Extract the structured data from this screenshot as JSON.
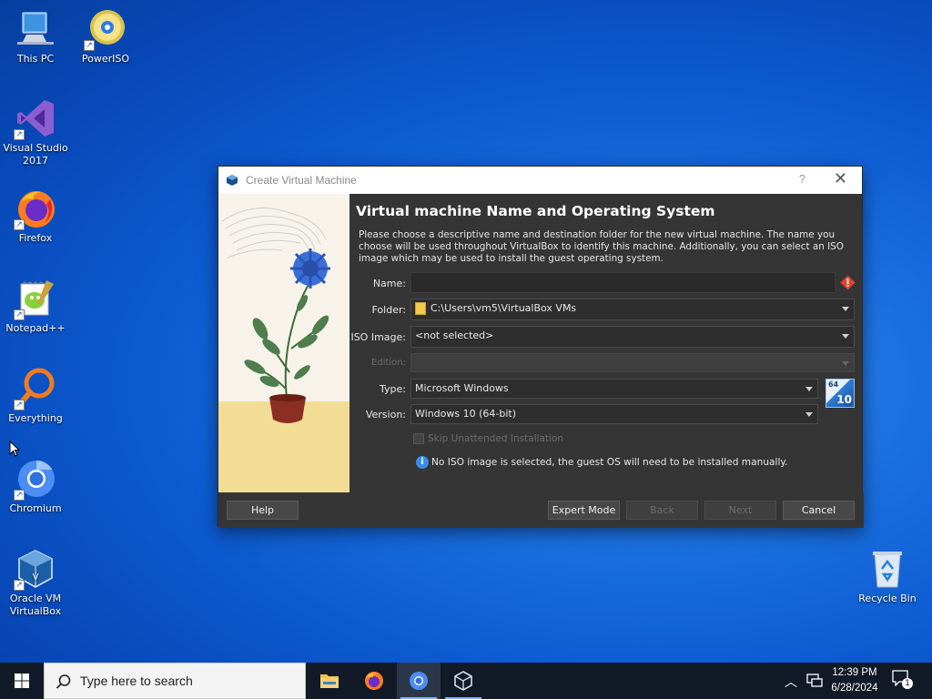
{
  "desktop": {
    "icons": [
      {
        "name": "this-pc",
        "label": "This PC"
      },
      {
        "name": "poweriso",
        "label": "PowerISO"
      },
      {
        "name": "visual-studio",
        "label": "Visual Studio 2017"
      },
      {
        "name": "firefox",
        "label": "Firefox"
      },
      {
        "name": "notepadpp",
        "label": "Notepad++"
      },
      {
        "name": "everything",
        "label": "Everything"
      },
      {
        "name": "chromium",
        "label": "Chromium"
      },
      {
        "name": "virtualbox",
        "label": "Oracle VM VirtualBox"
      },
      {
        "name": "recycle-bin",
        "label": "Recycle Bin"
      }
    ]
  },
  "dialog": {
    "title": "Create Virtual Machine",
    "help_glyph": "?",
    "close_glyph": "✕",
    "heading": "Virtual machine Name and Operating System",
    "description": "Please choose a descriptive name and destination folder for the new virtual machine. The name you choose will be used throughout VirtualBox to identify this machine. Additionally, you can select an ISO image which may be used to install the guest operating system.",
    "fields": {
      "name_label": "Name:",
      "name_value": "",
      "folder_label": "Folder:",
      "folder_value": "C:\\Users\\vm5\\VirtualBox VMs",
      "iso_label": "ISO Image:",
      "iso_value": "<not selected>",
      "edition_label": "Edition:",
      "edition_value": "",
      "type_label": "Type:",
      "type_value": "Microsoft Windows",
      "version_label": "Version:",
      "version_value": "Windows 10 (64-bit)",
      "skip_label": "Skip Unattended Installation",
      "info_text": "No ISO image is selected, the guest OS will need to be installed manually.",
      "os_badge_top": "64",
      "os_badge_num": "10"
    },
    "buttons": {
      "help": "Help",
      "expert": "Expert Mode",
      "back": "Back",
      "next": "Next",
      "cancel": "Cancel"
    }
  },
  "taskbar": {
    "search_placeholder": "Type here to search",
    "time": "12:39 PM",
    "date": "6/28/2024",
    "notification_count": "1"
  },
  "colors": {
    "desktop_blue": "#0d5ad0",
    "dialog_bg": "#353535",
    "taskbar_bg": "#111a26",
    "warning_red": "#e8402a",
    "info_blue": "#3a8ee6"
  }
}
